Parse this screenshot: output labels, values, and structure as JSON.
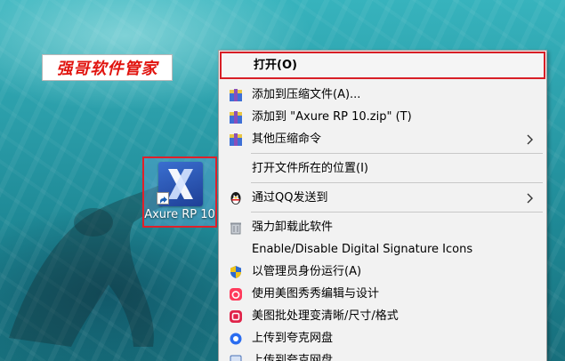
{
  "watermark": {
    "text": "强哥软件管家",
    "color": "#e1140f"
  },
  "desktop_icon": {
    "label": "Axure RP 10",
    "icon": "axure-x-icon"
  },
  "context_menu": {
    "open": "打开(O)",
    "add_archive": "添加到压缩文件(A)...",
    "add_zip": "添加到 \"Axure RP 10.zip\" (T)",
    "other_compress": "其他压缩命令",
    "open_location": "打开文件所在的位置(I)",
    "send_qq": "通过QQ发送到",
    "force_uninstall": "强力卸载此软件",
    "digital_signature": "Enable/Disable Digital Signature Icons",
    "run_as_admin": "以管理员身份运行(A)",
    "meitu_edit": "使用美图秀秀编辑与设计",
    "meitu_batch": "美图批处理变清晰/尺寸/格式",
    "upload_quark": "上传到夸克网盘",
    "upload_quark_2": "上传到夸克网盘"
  },
  "icons": {
    "archive": "winrar-archive-icon",
    "qq": "qq-penguin-icon",
    "trash": "uninstall-trash-icon",
    "shield": "uac-shield-icon",
    "meitu": "meitu-icon",
    "quark": "quark-icon"
  },
  "colors": {
    "highlight": "#d81f26",
    "menu_bg": "#f2f2f2"
  }
}
